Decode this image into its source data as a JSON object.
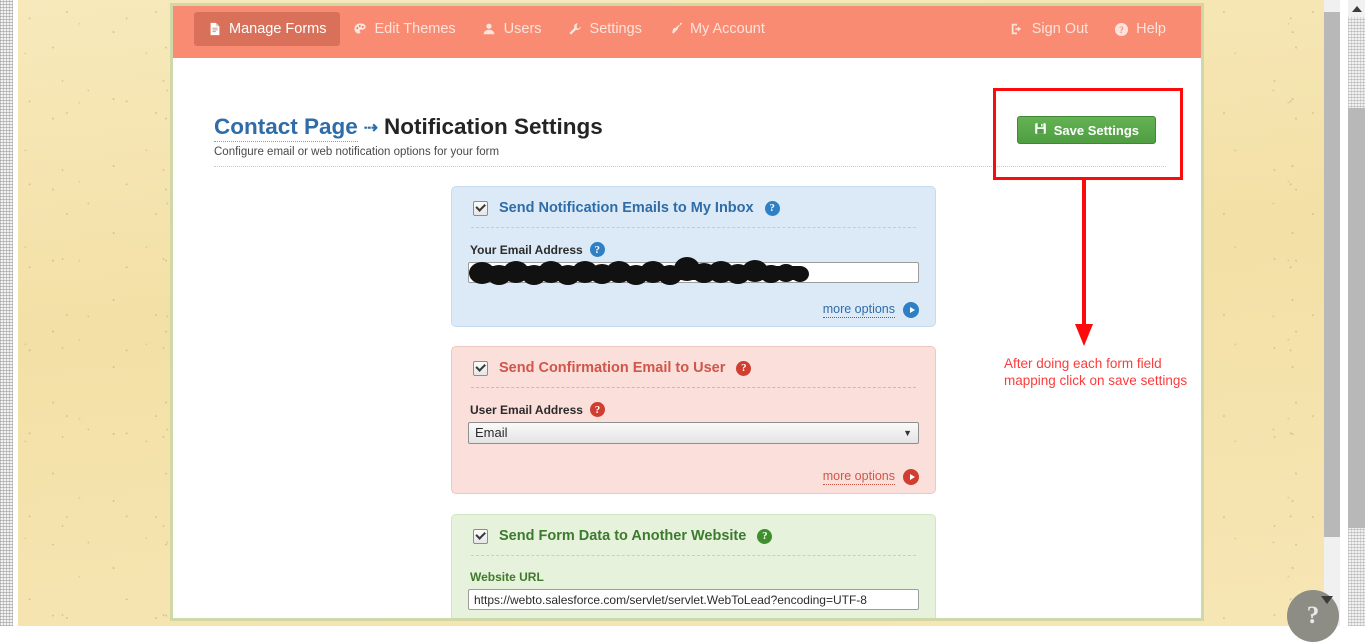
{
  "nav": {
    "left_items": [
      {
        "label": "Manage Forms",
        "icon": "document-icon",
        "active": true
      },
      {
        "label": "Edit Themes",
        "icon": "palette-icon",
        "active": false
      },
      {
        "label": "Users",
        "icon": "user-icon",
        "active": false
      },
      {
        "label": "Settings",
        "icon": "wrench-icon",
        "active": false
      },
      {
        "label": "My Account",
        "icon": "key-icon",
        "active": false
      }
    ],
    "right_items": [
      {
        "label": "Sign Out",
        "icon": "sign-out-icon"
      },
      {
        "label": "Help",
        "icon": "help-circle-icon"
      }
    ]
  },
  "header": {
    "breadcrumb_link": "Contact Page",
    "breadcrumb_arrow": "⇢",
    "title": "Notification Settings",
    "subtitle": "Configure email or web notification options for your form",
    "save_label": "Save Settings",
    "save_icon": "floppy-disk-icon"
  },
  "panels": [
    {
      "id": "notification-emails",
      "heading": "Send Notification Emails to My Inbox",
      "checked": true,
      "field_label": "Your Email Address",
      "field_value": "",
      "field_placeholder": "",
      "field_redacted": true,
      "more_label": "more options",
      "accent": "#2f6ca8",
      "background": "#dbeaf6"
    },
    {
      "id": "confirmation-email",
      "heading": "Send Confirmation Email to User",
      "checked": true,
      "field_label": "User Email Address",
      "select_value": "Email",
      "more_label": "more options",
      "accent": "#cf5648",
      "background": "#fadfdb"
    },
    {
      "id": "post-to-website",
      "heading": "Send Form Data to Another Website",
      "checked": true,
      "field_label": "Website URL",
      "field_value": "https://webto.salesforce.com/servlet/servlet.WebToLead?encoding=UTF-8",
      "accent": "#3c7a2e",
      "background": "#e7f2dc"
    }
  ],
  "annotation": {
    "text": "After doing each form field mapping click on save settings",
    "color": "#fc3c3c"
  },
  "help_fab": {
    "label": "?"
  }
}
